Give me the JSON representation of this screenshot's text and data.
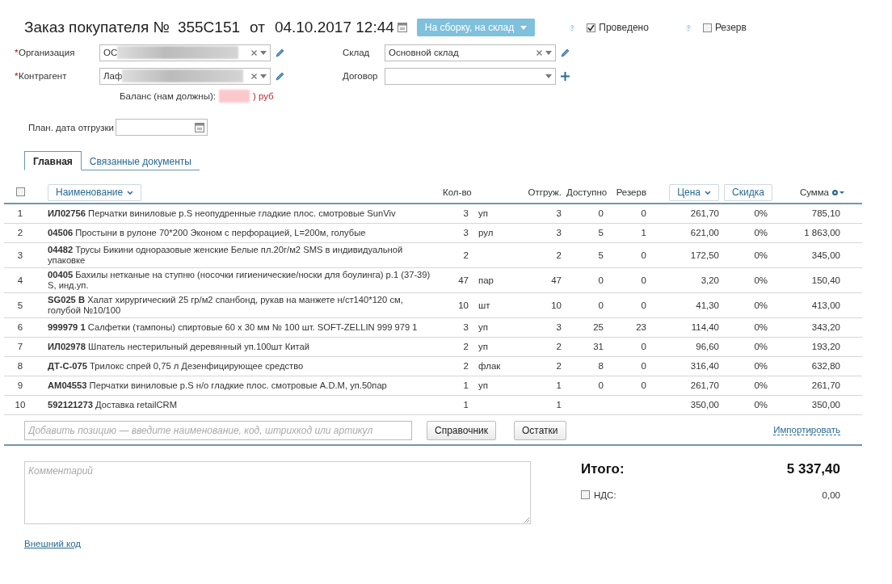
{
  "header": {
    "title": "Заказ покупателя №",
    "number": "355С151",
    "date_prefix": "от",
    "date": "04.10.2017 12:44",
    "status_button": "На сборку, на склад",
    "flags": [
      {
        "label": "Проведено",
        "checked": true
      },
      {
        "label": "Резерв",
        "checked": false
      }
    ]
  },
  "form": {
    "left": [
      {
        "required_mark": "*",
        "label": "Организация",
        "value": "ОС",
        "redacted": true,
        "clearable": true,
        "kind": "edit"
      },
      {
        "required_mark": "*",
        "label": "Контрагент",
        "value": "Лаф",
        "redacted": true,
        "clearable": true,
        "kind": "edit"
      }
    ],
    "right": [
      {
        "label": "Склад",
        "value": "Основной склад",
        "redacted": false,
        "clearable": true,
        "kind": "edit"
      },
      {
        "label": "Договор",
        "redacted": false,
        "clearable": false,
        "kind": "add"
      }
    ],
    "balance": {
      "label": "Баланс (нам должны):",
      "value": ") руб",
      "redacted": true
    },
    "ship_date": {
      "label": "План. дата отгрузки"
    }
  },
  "tabs": [
    {
      "label": "Главная",
      "selected": true
    },
    {
      "label": "Связанные документы",
      "selected": false
    }
  ],
  "table": {
    "select_all": false,
    "columns": [
      {
        "label": "Наименование",
        "kind": "sort"
      },
      {
        "label": "Кол-во",
        "kind": "plain"
      },
      {
        "label": "Отгруж.",
        "kind": "plain"
      },
      {
        "label": "Доступно",
        "kind": "plain"
      },
      {
        "label": "Резерв",
        "kind": "plain"
      },
      {
        "label": "Цена",
        "kind": "sort"
      },
      {
        "label": "Скидка",
        "kind": "button"
      },
      {
        "label": "Сумма",
        "kind": "settings"
      }
    ],
    "rows": [
      {
        "num": "1",
        "code": "ИЛ02756",
        "name": "Перчатки виниловые p.S неопудренные гладкие плос. смотровые SunViv",
        "qty": "3",
        "unit": "уп",
        "shipped": "3",
        "available": "0",
        "reserve": "0",
        "price": "261,70",
        "discount": "0%",
        "sum": "785,10"
      },
      {
        "num": "2",
        "code": "04506",
        "name": "Простыни в рулоне 70*200 Эконом с перфорацией, L=200м, голубые",
        "qty": "3",
        "unit": "рул",
        "shipped": "3",
        "available": "5",
        "reserve": "1",
        "price": "621,00",
        "discount": "0%",
        "sum": "1 863,00"
      },
      {
        "num": "3",
        "code": "04482",
        "name": "Трусы Бикини одноразовые женские Белые пл.20г/м2 SMS в индивидуальной упаковке",
        "qty": "2",
        "shipped": "2",
        "available": "5",
        "reserve": "0",
        "price": "172,50",
        "discount": "0%",
        "sum": "345,00"
      },
      {
        "num": "4",
        "code": "00405",
        "name": "Бахилы нетканые на ступню (носочки гигиенические/носки для боулинга) р.1 (37-39) S, инд.уп.",
        "qty": "47",
        "unit": "пар",
        "shipped": "47",
        "available": "0",
        "reserve": "0",
        "price": "3,20",
        "discount": "0%",
        "sum": "150,40"
      },
      {
        "num": "5",
        "code": "SG025 B",
        "name": "Халат хирургический 25 гр/м2 спанбонд, рукав на манжете н/ст140*120 см, голубой №10/100",
        "qty": "10",
        "unit": "шт",
        "shipped": "10",
        "available": "0",
        "reserve": "0",
        "price": "41,30",
        "discount": "0%",
        "sum": "413,00"
      },
      {
        "num": "6",
        "code": "999979 1",
        "name": "Салфетки (тампоны) спиртовые 60 х 30 мм № 100 шт. SOFT-ZELLIN 999 979 1",
        "qty": "3",
        "unit": "уп",
        "shipped": "3",
        "available": "25",
        "reserve": "23",
        "price": "114,40",
        "discount": "0%",
        "sum": "343,20"
      },
      {
        "num": "7",
        "code": "ИЛ02978",
        "name": "Шпатель нестерильный деревянный уп.100шт Китай",
        "qty": "2",
        "unit": "уп",
        "shipped": "2",
        "available": "31",
        "reserve": "0",
        "price": "96,60",
        "discount": "0%",
        "sum": "193,20"
      },
      {
        "num": "8",
        "code": "ДТ-С-075",
        "name": "Трилокс спрей 0,75 л Дезенфицирующее средство",
        "qty": "2",
        "unit": "флак",
        "shipped": "2",
        "available": "8",
        "reserve": "0",
        "price": "316,40",
        "discount": "0%",
        "sum": "632,80"
      },
      {
        "num": "9",
        "code": "АМ04553",
        "name": "Перчатки виниловые p.S н/о гладкие плос. смотровые A.D.M, уп.50пар",
        "qty": "1",
        "unit": "уп",
        "shipped": "1",
        "available": "0",
        "reserve": "0",
        "price": "261,70",
        "discount": "0%",
        "sum": "261,70"
      },
      {
        "num": "10",
        "code": "592121273",
        "name": "Доставка retailCRM",
        "qty": "1",
        "shipped": "1",
        "price": "350,00",
        "discount": "0%",
        "sum": "350,00"
      }
    ]
  },
  "add_row": {
    "placeholder": "Добавить позицию — введите наименование, код, штрихкод или артикул",
    "buttons": [
      "Справочник",
      "Остатки"
    ],
    "import_link": "Импортировать"
  },
  "comment": {
    "placeholder": "Комментарий"
  },
  "totals": {
    "label": "Итого:",
    "value": "5 337,40",
    "vat": {
      "label": "НДС:",
      "checked": false,
      "value": "0,00"
    }
  },
  "external_code_link": "Внешний код"
}
